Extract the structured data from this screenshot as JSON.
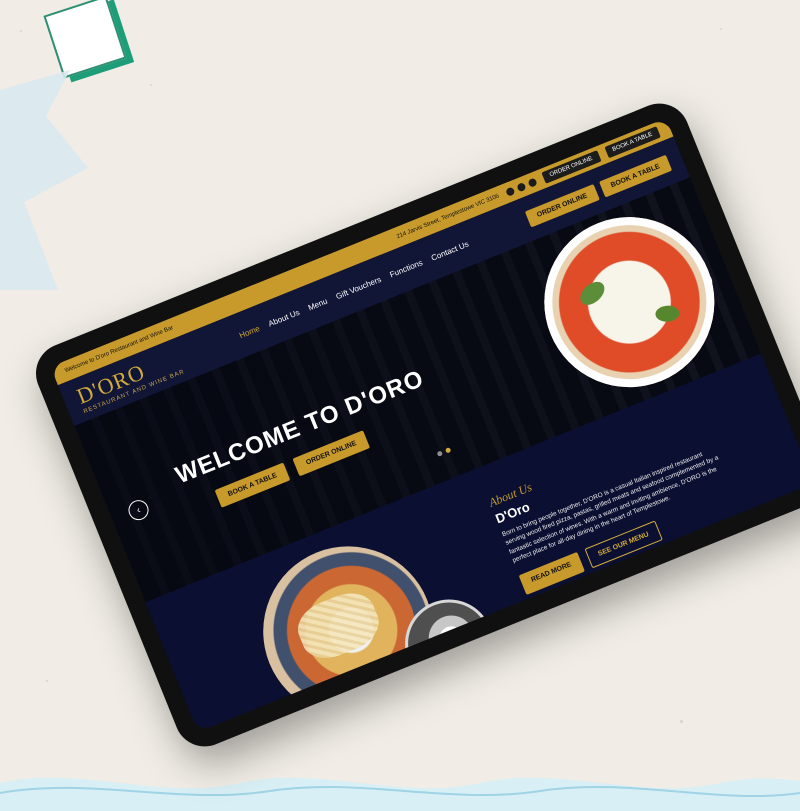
{
  "topbar": {
    "welcome": "Welcome to D'oro Restaurant and Wine Bar",
    "address": "214 Jarvis Street, Templestowe VIC 3106",
    "order_online": "ORDER ONLINE",
    "book_table": "BOOK A TABLE"
  },
  "nav": {
    "logo": "D'ORO",
    "tagline": "RESTAURANT AND WINE BAR",
    "items": [
      {
        "label": "Home"
      },
      {
        "label": "About Us"
      },
      {
        "label": "Menu"
      },
      {
        "label": "Gift Vouchers"
      },
      {
        "label": "Functions"
      },
      {
        "label": "Contact Us"
      }
    ],
    "cta_order": "ORDER ONLINE",
    "cta_book": "BOOK A TABLE"
  },
  "hero": {
    "title": "WELCOME TO D'ORO",
    "book_table": "BOOK A TABLE",
    "order_online": "ORDER ONLINE"
  },
  "about": {
    "kicker": "About Us",
    "title": "D'Oro",
    "body": "Born to bring people together, D'ORO is a casual Italian inspired restaurant serving wood fired pizza, pastas, grilled meats and seafood complemented by a fantastic selection of wines. With a warm and inviting ambience, D'ORO is the perfect place for all-day dining in the heart of Templestowe.",
    "read_more": "READ MORE",
    "see_menu": "SEE OUR MENU"
  }
}
